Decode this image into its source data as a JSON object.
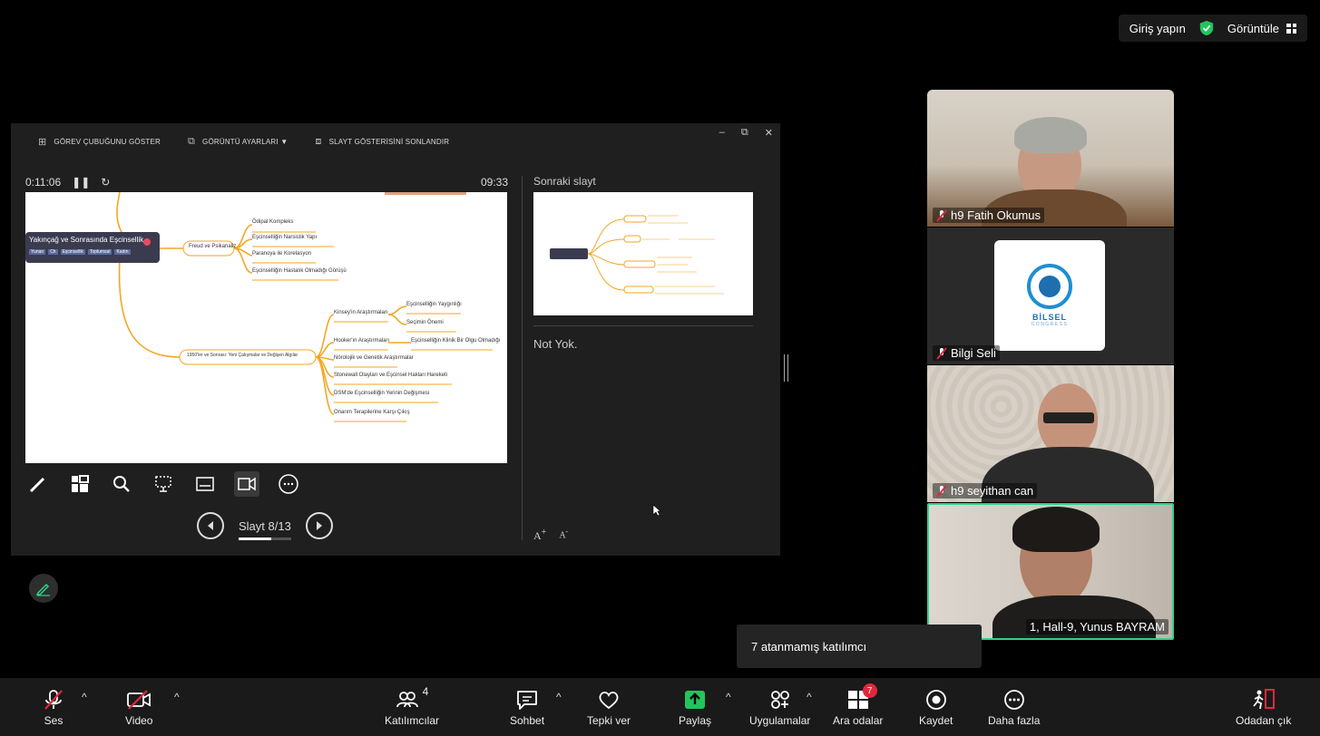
{
  "topbar": {
    "signin": "Giriş yapın",
    "view": "Görüntüle"
  },
  "share": {
    "toolbar": {
      "taskbar": "GÖREV ÇUBUĞUNU GÖSTER",
      "display": "GÖRÜNTÜ AYARLARI ▼",
      "end": "SLAYT GÖSTERİSİNİ SONLANDIR"
    },
    "elapsed": "0:11:06",
    "clock": "09:33",
    "slide_count": "Slayt 8/13",
    "next_label": "Sonraki slayt",
    "notes": "Not Yok.",
    "font_up": "A",
    "font_down": "A",
    "mindmap": {
      "root": "Yakınçağ ve Sonrasında Eşcinsellik",
      "root_tags": [
        "Yunan",
        "Ch",
        "Eşcinsellik",
        "Toplumsal",
        "Kadın"
      ],
      "freud": "Freud ve Psikanaliz",
      "freud_items": [
        "Ödipal Kompleks",
        "Eşcinselliğin Narsistik Yapı",
        "Paranoya ile Korelasyon",
        "Eşcinselliğin Hastalık Olmadığı Görüşü"
      ],
      "era": "1950'ler ve Sonrası: Yeni Çalışmalar ve Değişen Algılar",
      "kinsey": "Kinsey'in Araştırmaları",
      "kinsey_items": [
        "Eşcinselliğin Yaygınlığı",
        "Seçimin Önemi"
      ],
      "hooker": "Hooker'ın Araştırmaları",
      "hooker_item": "Eşcinselliğin Klinik Bir Olgu Olmadığı",
      "others": [
        "Nörolojik ve Genetik Araştırmalar",
        "Stonewall Olayları ve Eşcinsel Hakları Hareketi",
        "DSM'de Eşcinselliğin Yerinin Değişmesi",
        "Onarım Terapilerine Karşı Çıkış"
      ]
    }
  },
  "participants": [
    {
      "name": "h9 Fatih Okumus",
      "muted": true
    },
    {
      "name": "Bilgi Seli",
      "muted": true,
      "logo": "BİLSEL",
      "logo_sub": "CONGRESS"
    },
    {
      "name": "h9 seyithan can",
      "muted": true
    },
    {
      "name": "1, Hall-9, Yunus BAYRAM",
      "muted": false,
      "speaking": true
    }
  ],
  "tooltip": "7 atanmamış katılımcı",
  "bottombar": {
    "audio": "Ses",
    "video": "Video",
    "participants": "Katılımcılar",
    "participants_count": "4",
    "chat": "Sohbet",
    "react": "Tepki ver",
    "share": "Paylaş",
    "apps": "Uygulamalar",
    "breakout": "Ara odalar",
    "breakout_badge": "7",
    "record": "Kaydet",
    "more": "Daha fazla",
    "leave": "Odadan çık"
  },
  "colors": {
    "accent_green": "#2fd28b",
    "share_green": "#23c45e",
    "leave_red": "#e0283c",
    "mic_muted": "#e0283c"
  }
}
